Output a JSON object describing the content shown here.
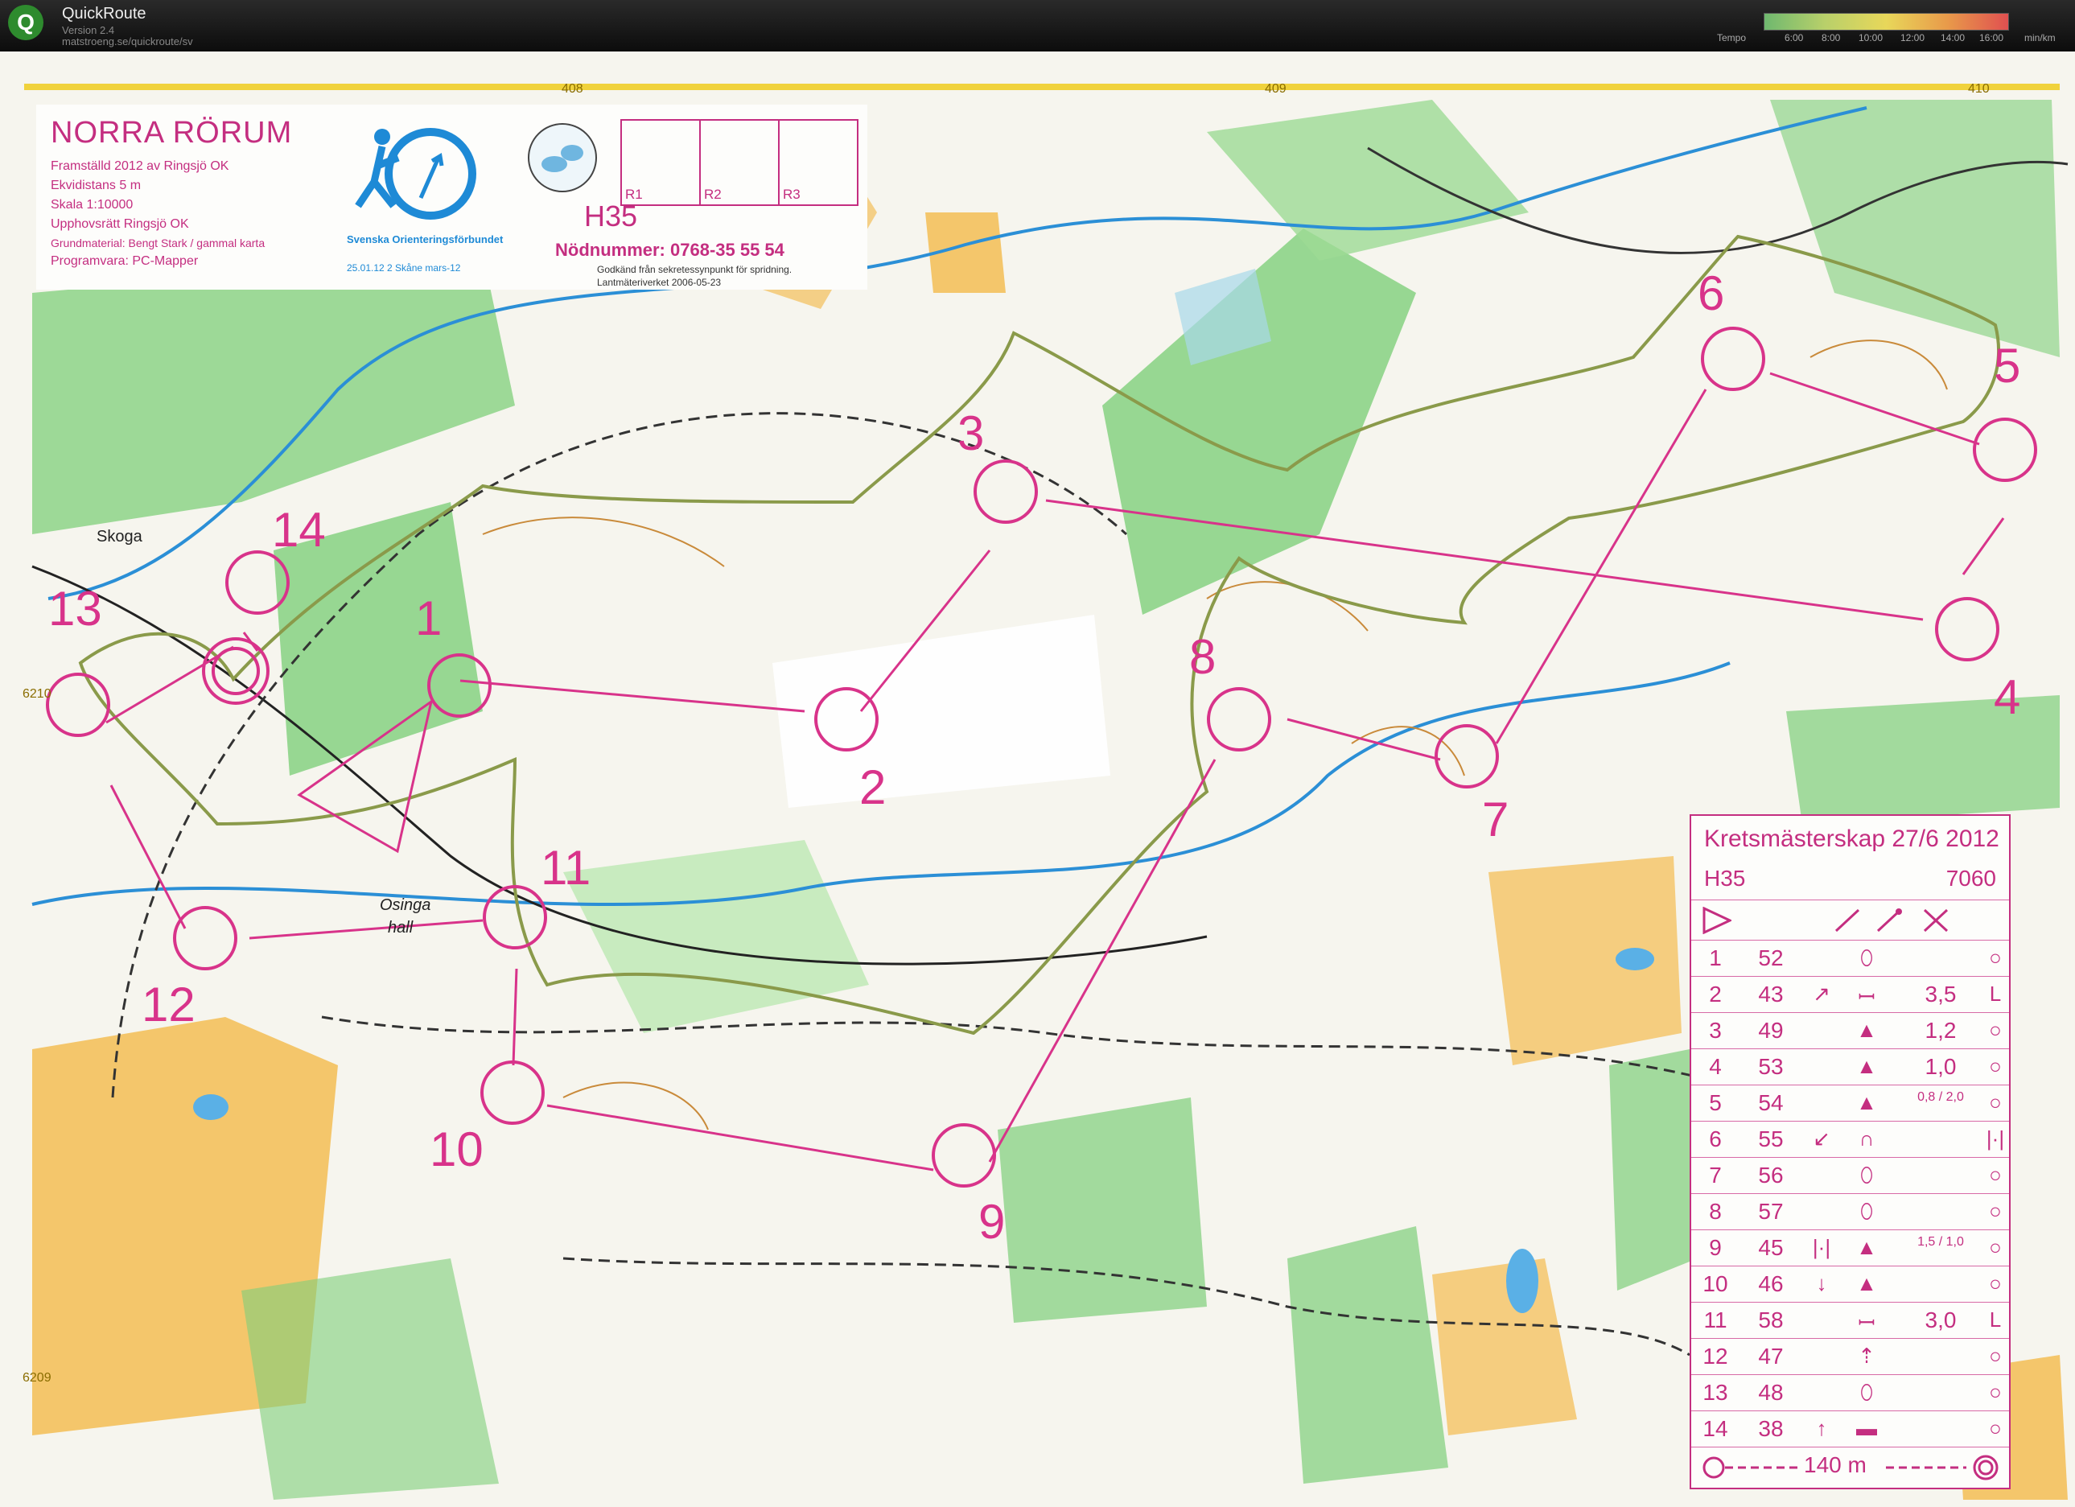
{
  "app": {
    "name": "QuickRoute",
    "version": "Version 2.4",
    "url": "matstroeng.se/quickroute/sv",
    "logo_letter": "Q"
  },
  "tempo_legend": {
    "label": "Tempo",
    "ticks": [
      "6:00",
      "8:00",
      "10:00",
      "12:00",
      "14:00",
      "16:00"
    ],
    "unit": "min/km"
  },
  "map_info": {
    "title": "NORRA RÖRUM",
    "lines": [
      "Framställd 2012 av Ringsjö OK",
      "Ekvidistans 5 m",
      "Skala   1:10000",
      "Upphovsrätt Ringsjö OK",
      "Grundmaterial: Bengt Stark / gammal karta",
      "Programvara: PC-Mapper"
    ],
    "federation": "Svenska Orienteringsförbundet",
    "federation_line2": "25.01.12 2 Skåne mars-12",
    "course": "H35",
    "emergency": "Nödnummer: 0768-35 55 54",
    "approval": "Godkänd från sekretessynpunkt för spridning.",
    "approval2": "Lantmäteriverket 2006-05-23",
    "relay_boxes": [
      "R1",
      "R2",
      "R3"
    ]
  },
  "grid_labels": {
    "top": [
      "408",
      "409",
      "410"
    ],
    "left": [
      "6210",
      "6209"
    ]
  },
  "place_names": [
    "Skoga",
    "Osinga",
    "hall"
  ],
  "controls": [
    "1",
    "2",
    "3",
    "4",
    "5",
    "6",
    "7",
    "8",
    "9",
    "10",
    "11",
    "12",
    "13",
    "14"
  ],
  "description_sheet": {
    "title": "Kretsmästerskap 27/6 2012",
    "class": "H35",
    "length": "7060",
    "rows": [
      {
        "n": "1",
        "code": "52",
        "dir": "",
        "feat": "⬯",
        "dim": "",
        "loc": "○"
      },
      {
        "n": "2",
        "code": "43",
        "dir": "↗",
        "feat": "ꟷ",
        "dim": "3,5",
        "loc": "L"
      },
      {
        "n": "3",
        "code": "49",
        "dir": "",
        "feat": "▲",
        "dim": "1,2",
        "loc": "○"
      },
      {
        "n": "4",
        "code": "53",
        "dir": "",
        "feat": "▲",
        "dim": "1,0",
        "loc": "○"
      },
      {
        "n": "5",
        "code": "54",
        "dir": "",
        "feat": "▲",
        "dim": "0,8 / 2,0",
        "loc": "○"
      },
      {
        "n": "6",
        "code": "55",
        "dir": "↙",
        "feat": "∩",
        "dim": "",
        "loc": "|·|"
      },
      {
        "n": "7",
        "code": "56",
        "dir": "",
        "feat": "⬯",
        "dim": "",
        "loc": "○"
      },
      {
        "n": "8",
        "code": "57",
        "dir": "",
        "feat": "⬯",
        "dim": "",
        "loc": "○"
      },
      {
        "n": "9",
        "code": "45",
        "dir": "|·|",
        "feat": "▲",
        "dim": "1,5 / 1,0",
        "loc": "○"
      },
      {
        "n": "10",
        "code": "46",
        "dir": "↓",
        "feat": "▲",
        "dim": "",
        "loc": "○"
      },
      {
        "n": "11",
        "code": "58",
        "dir": "",
        "feat": "ꟷ",
        "dim": "3,0",
        "loc": "L"
      },
      {
        "n": "12",
        "code": "47",
        "dir": "",
        "feat": "⇡",
        "dim": "",
        "loc": "○"
      },
      {
        "n": "13",
        "code": "48",
        "dir": "",
        "feat": "⬯",
        "dim": "",
        "loc": "○"
      },
      {
        "n": "14",
        "code": "38",
        "dir": "↑",
        "feat": "▬",
        "dim": "",
        "loc": "○"
      }
    ],
    "finish": "140 m"
  },
  "colors": {
    "course": "#d8338a",
    "forest": "#7fcf7a",
    "open": "#f4c66b",
    "water": "#2b8fd6",
    "route": "#8a9a4a"
  }
}
